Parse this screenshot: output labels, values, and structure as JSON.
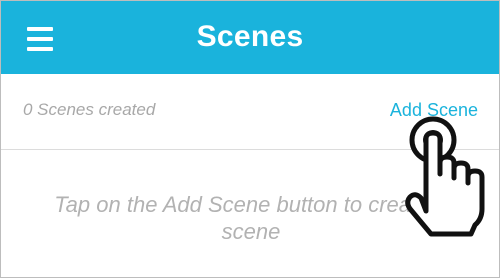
{
  "app_bar": {
    "title": "Scenes",
    "menu_icon": "hamburger-menu-icon",
    "background_color": "#1ab3dc",
    "text_color": "#ffffff"
  },
  "scenes": {
    "count_label": "0 Scenes created",
    "add_label": "Add Scene",
    "accent_color": "#1ab3dc"
  },
  "empty_state": {
    "message": "Tap on the Add Scene button to create a scene"
  },
  "overlay": {
    "gesture_icon": "tap-hand-icon"
  }
}
